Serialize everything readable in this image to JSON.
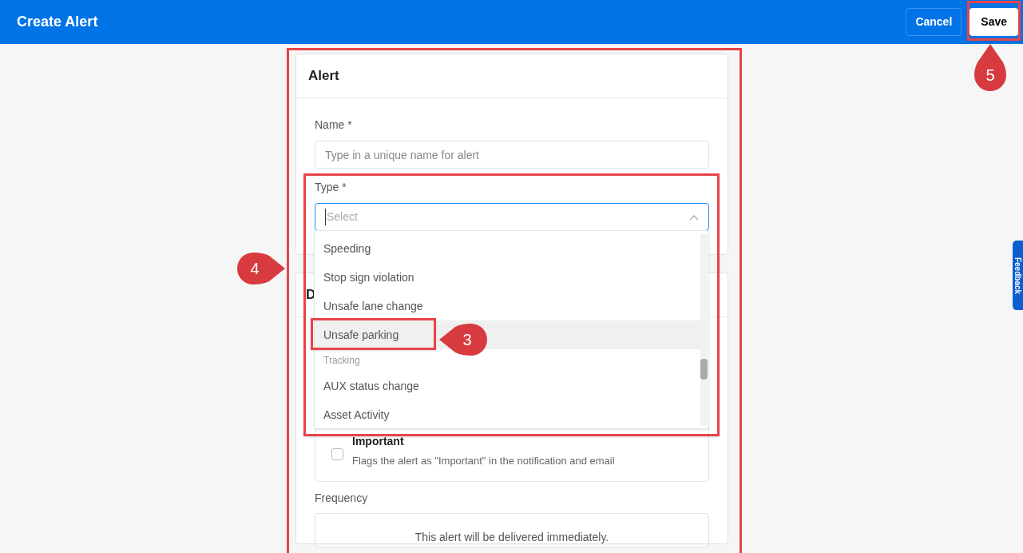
{
  "header": {
    "title": "Create Alert",
    "buttons": [
      {
        "label": "Cancel",
        "kind": "outline"
      },
      {
        "label": "Save",
        "kind": "solid"
      }
    ]
  },
  "alert_card": {
    "title": "Alert",
    "name_field": {
      "label": "Name *",
      "placeholder": "Type in a unique name for alert"
    },
    "type_field": {
      "label": "Type *",
      "placeholder": "Select",
      "expanded": true
    }
  },
  "type_dropdown": {
    "items": [
      {
        "label": "Speeding",
        "kind": "option",
        "selected": false
      },
      {
        "label": "Stop sign violation",
        "kind": "option",
        "selected": false
      },
      {
        "label": "Unsafe lane change",
        "kind": "option",
        "selected": false
      },
      {
        "label": "Unsafe parking",
        "kind": "option",
        "selected": true
      },
      {
        "label": "Tracking",
        "kind": "group"
      },
      {
        "label": "AUX status change",
        "kind": "option",
        "selected": false
      },
      {
        "label": "Asset Activity",
        "kind": "option",
        "selected": false
      }
    ]
  },
  "details_card": {
    "title": "D",
    "important": {
      "label": "Important",
      "description": "Flags the alert as \"Important\" in the notification and email",
      "checked": false
    },
    "frequency": {
      "label": "Frequency",
      "text": "This alert will be delivered immediately."
    }
  },
  "feedback_tab": {
    "label": "Feedback"
  },
  "annotations": [
    {
      "number": "3"
    },
    {
      "number": "4"
    },
    {
      "number": "5"
    }
  ]
}
